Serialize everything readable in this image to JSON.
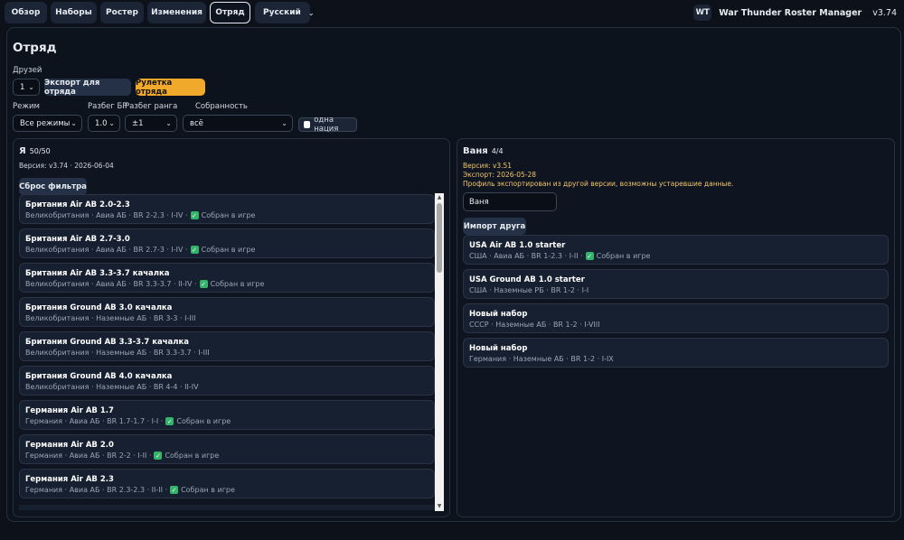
{
  "nav": {
    "tabs": [
      "Обзор",
      "Наборы",
      "Ростер",
      "Изменения",
      "Отряд"
    ],
    "active": "Отряд",
    "language": "Русский"
  },
  "brand": {
    "logo": "WT",
    "title": "War Thunder Roster Manager",
    "version": "v3.74"
  },
  "page": {
    "title": "Отряд"
  },
  "friends": {
    "label": "Друзей",
    "value": "1",
    "export_label": "Экспорт для отряда",
    "roulette_label": "Рулетка отряда"
  },
  "filters": {
    "mode_label": "Режим",
    "mode_value": "Все режимы",
    "br_label": "Разбег БР",
    "br_value": "1.0",
    "rank_label": "Разбег ранга",
    "rank_value": "±1",
    "collected_label": "Собранность",
    "collected_value": "всё",
    "one_nation_label": "одна нация"
  },
  "me": {
    "name": "Я",
    "count": "50/50",
    "meta": "Версия: v3.74 · 2026-06-04",
    "reset_label": "Сброс фильтра",
    "items": [
      {
        "title": "Британия Air AB 2.0-2.3",
        "sub": "Великобритания · Авиа АБ · BR 2-2.3 · I-IV ·",
        "collected": "Собран в игре"
      },
      {
        "title": "Британия Air AB 2.7-3.0",
        "sub": "Великобритания · Авиа АБ · BR 2.7-3 · I-IV ·",
        "collected": "Собран в игре"
      },
      {
        "title": "Британия Air AB 3.3-3.7 качалка",
        "sub": "Великобритания · Авиа АБ · BR 3.3-3.7 · II-IV ·",
        "collected": "Собран в игре"
      },
      {
        "title": "Британия Ground AB 3.0 качалка",
        "sub": "Великобритания · Наземные АБ · BR 3-3 · I-III",
        "collected": ""
      },
      {
        "title": "Британия Ground AB 3.3-3.7 качалка",
        "sub": "Великобритания · Наземные АБ · BR 3.3-3.7 · I-III",
        "collected": ""
      },
      {
        "title": "Британия Ground AB 4.0 качалка",
        "sub": "Великобритания · Наземные АБ · BR 4-4 · II-IV",
        "collected": ""
      },
      {
        "title": "Германия Air AB 1.7",
        "sub": "Германия · Авиа АБ · BR 1.7-1.7 · I-I ·",
        "collected": "Собран в игре"
      },
      {
        "title": "Германия Air AB 2.0",
        "sub": "Германия · Авиа АБ · BR 2-2 · I-II ·",
        "collected": "Собран в игре"
      },
      {
        "title": "Германия Air AB 2.3",
        "sub": "Германия · Авиа АБ · BR 2.3-2.3 · II-II ·",
        "collected": "Собран в игре"
      }
    ]
  },
  "friend": {
    "name": "Ваня",
    "count": "4/4",
    "version": "Версия: v3.51",
    "export": "Экспорт: 2026-05-28",
    "warning": "Профиль экспортирован из другой версии, возможны устаревшие данные.",
    "name_input": "Ваня",
    "import_label": "Импорт друга",
    "items": [
      {
        "title": "USA Air AB 1.0 starter",
        "sub": "США · Авиа АБ · BR 1-2.3 · I-II ·",
        "collected": "Собран в игре"
      },
      {
        "title": "USA Ground AB 1.0 starter",
        "sub": "США · Наземные РБ · BR 1-2 · I-I",
        "collected": ""
      },
      {
        "title": "Новый набор",
        "sub": "СССР · Наземные АБ · BR 1-2 · I-VIII",
        "collected": ""
      },
      {
        "title": "Новый набор",
        "sub": "Германия · Наземные АБ · BR 1-2 · I-IX",
        "collected": ""
      }
    ]
  },
  "colors": {
    "accent": "#f0a92a",
    "ok": "#34b36b",
    "warn": "#f2c46b"
  }
}
